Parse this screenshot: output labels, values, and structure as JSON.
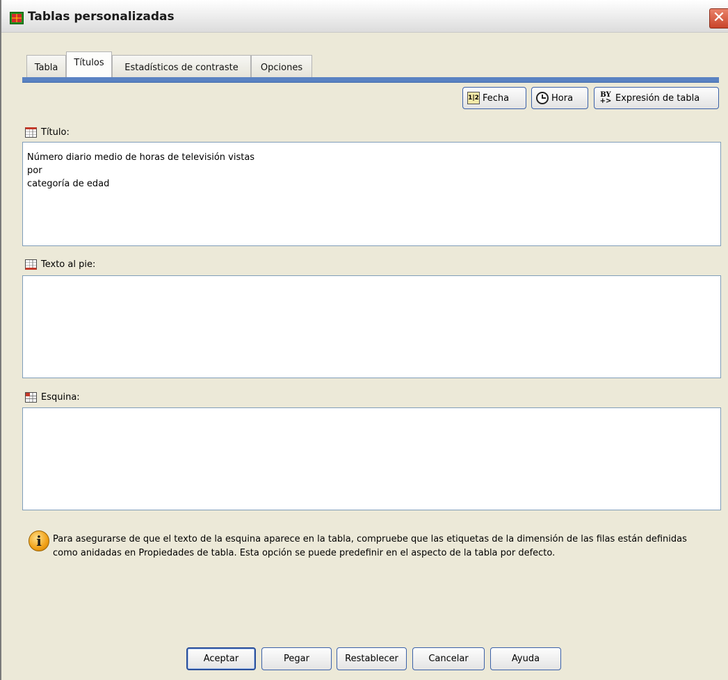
{
  "window": {
    "title": "Tablas personalizadas",
    "close_glyph": "✕"
  },
  "tabs": [
    {
      "label": "Tabla",
      "active": false
    },
    {
      "label": "Títulos",
      "active": true
    },
    {
      "label": "Estadísticos de contraste",
      "active": false
    },
    {
      "label": "Opciones",
      "active": false
    }
  ],
  "toolbar": {
    "date_label": "Fecha",
    "date_icon_text": "1|2",
    "time_label": "Hora",
    "expression_label": "Expresión de tabla",
    "expression_icon_text": "BY\n+>"
  },
  "sections": {
    "title_label": "Título:",
    "title_value": "Número diario medio de horas de televisión vistas\npor\ncategoría de edad",
    "footer_label": "Texto al pie:",
    "footer_value": "",
    "corner_label": "Esquina:",
    "corner_value": ""
  },
  "info": {
    "icon_glyph": "i",
    "text": "Para asegurarse de que el texto de la esquina aparece en la tabla, compruebe que las etiquetas de la dimensión de las filas están definidas como anidadas en Propiedades de tabla. Esta opción se puede predefinir en el aspecto de la tabla por defecto."
  },
  "buttons": {
    "ok": "Aceptar",
    "paste": "Pegar",
    "reset": "Restablecer",
    "cancel": "Cancelar",
    "help": "Ayuda"
  },
  "colors": {
    "accent": "#5a82c2",
    "dialog_bg": "#ece9d8",
    "close_button": "#c9442a"
  }
}
